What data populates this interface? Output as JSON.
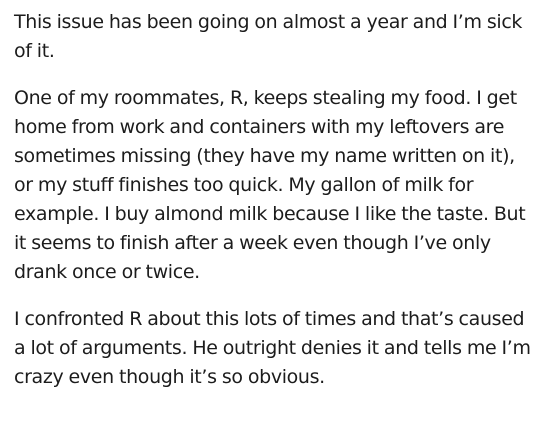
{
  "post": {
    "paragraphs": [
      "This issue has been going on almost a year and I’m sick of it.",
      "One of my roommates, R, keeps stealing my food. I get home from work and containers with my leftovers are sometimes missing (they have my name written on it), or my stuff finishes too quick. My gallon of milk for example. I buy almond milk because I like the taste. But it seems to finish after a week even though I’ve only drank once or twice.",
      "I confronted R about this lots of times and that’s caused a lot of arguments. He outright denies it and tells me I’m crazy even though it’s so obvious."
    ]
  }
}
